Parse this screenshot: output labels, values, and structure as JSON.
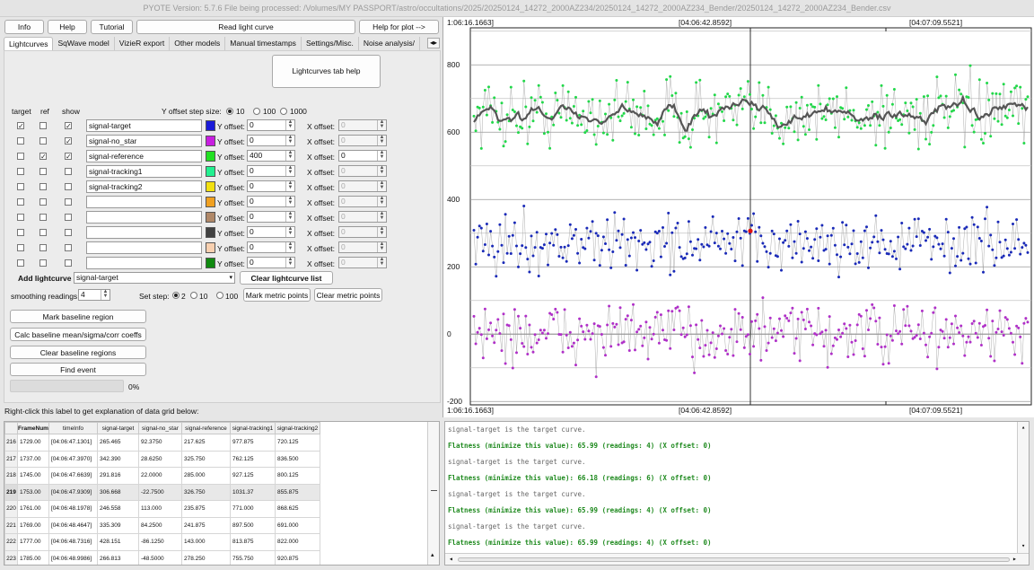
{
  "window": {
    "title": "PYOTE Version: 5.7.6  File being processed: /Volumes/MY PASSPORT/astro/occultations/2025/20250124_14272_2000AZ234/20250124_14272_2000AZ234_Bender/20250124_14272_2000AZ234_Bender.csv"
  },
  "toolbar": {
    "info": "Info",
    "help": "Help",
    "tutorial": "Tutorial",
    "read_light_curve": "Read light curve",
    "help_for_plot": "Help for plot -->"
  },
  "tabs": [
    "Lightcurves",
    "SqWave model",
    "VizieR export",
    "Other models",
    "Manual timestamps",
    "Settings/Misc.",
    "Noise analysis/"
  ],
  "lightcurves_tab": {
    "help_button": "Lightcurves tab help",
    "headers": {
      "target": "target",
      "ref": "ref",
      "show": "show"
    },
    "y_offset_step": {
      "label": "Y offset step size:",
      "options": [
        "10",
        "100",
        "1000"
      ],
      "selected": "10"
    },
    "y_offset_label": "Y offset:",
    "x_offset_label": "X offset:",
    "rows": [
      {
        "name": "signal-target",
        "target": true,
        "ref": false,
        "show": true,
        "color": "#1a1ad8",
        "y_offset": "0",
        "x_offset": "0",
        "x_enabled": false
      },
      {
        "name": "signal-no_star",
        "target": false,
        "ref": false,
        "show": true,
        "color": "#c81ee0",
        "y_offset": "0",
        "x_offset": "0",
        "x_enabled": false
      },
      {
        "name": "signal-reference",
        "target": false,
        "ref": true,
        "show": true,
        "color": "#22e022",
        "y_offset": "400",
        "x_offset": "0",
        "x_enabled": true
      },
      {
        "name": "signal-tracking1",
        "target": false,
        "ref": false,
        "show": false,
        "color": "#22f090",
        "y_offset": "0",
        "x_offset": "0",
        "x_enabled": false
      },
      {
        "name": "signal-tracking2",
        "target": false,
        "ref": false,
        "show": false,
        "color": "#f2e010",
        "y_offset": "0",
        "x_offset": "0",
        "x_enabled": false
      },
      {
        "name": "",
        "target": false,
        "ref": false,
        "show": false,
        "color": "#f0a020",
        "y_offset": "0",
        "x_offset": "0",
        "x_enabled": false
      },
      {
        "name": "",
        "target": false,
        "ref": false,
        "show": false,
        "color": "#b08868",
        "y_offset": "0",
        "x_offset": "0",
        "x_enabled": false
      },
      {
        "name": "",
        "target": false,
        "ref": false,
        "show": false,
        "color": "#404040",
        "y_offset": "0",
        "x_offset": "0",
        "x_enabled": false
      },
      {
        "name": "",
        "target": false,
        "ref": false,
        "show": false,
        "color": "#f8d0b0",
        "y_offset": "0",
        "x_offset": "0",
        "x_enabled": false
      },
      {
        "name": "",
        "target": false,
        "ref": false,
        "show": false,
        "color": "#108a10",
        "y_offset": "0",
        "x_offset": "0",
        "x_enabled": false
      }
    ],
    "add_lightcurve_label": "Add lightcurve",
    "add_lightcurve_value": "signal-target",
    "clear_list_button": "Clear lightcurve list",
    "smoothing_label": "smoothing readings",
    "smoothing_value": "4",
    "set_step_label": "Set step:",
    "set_step_options": [
      "2",
      "10",
      "100"
    ],
    "set_step_selected": "2",
    "mark_metric_button": "Mark metric points",
    "clear_metric_button": "Clear metric points",
    "mark_baseline_button": "Mark baseline region",
    "calc_baseline_button": "Calc baseline mean/sigma/corr coeffs",
    "clear_baseline_button": "Clear baseline regions",
    "find_event_button": "Find event",
    "progress_percent": 0,
    "progress_label": "0%"
  },
  "plot": {
    "top_time_labels": [
      "1:06:16.1663]",
      "[04:06:42.8592]",
      "[04:07:09.5521]"
    ],
    "bottom_time_labels": [
      "1:06:16.1663]",
      "[04:06:42.8592]",
      "[04:07:09.5521]"
    ],
    "y_ticks": [
      "800",
      "600",
      "400",
      "200",
      "0",
      "-200"
    ]
  },
  "chart_data": {
    "type": "scatter",
    "title": "",
    "xlabel": "",
    "ylabel": "",
    "ylim": [
      -210,
      910
    ],
    "y_ticks": [
      800,
      600,
      400,
      200,
      0,
      -200
    ],
    "grid": true,
    "cursor_frame": 1753,
    "highlight_point": {
      "series": "signal-target",
      "frame": 1753,
      "y": 306.668
    },
    "series": [
      {
        "name": "signal-reference",
        "color": "#22d84a",
        "mean": 655,
        "sigma": 85,
        "smoothed": true,
        "y_offset": 400
      },
      {
        "name": "signal-target",
        "color": "#1a2ab8",
        "mean": 270,
        "sigma": 70
      },
      {
        "name": "signal-no_star",
        "color": "#b030c8",
        "mean": 0,
        "sigma": 75
      }
    ]
  },
  "grid_help_label": "Right-click this label to get explanation of data grid below:",
  "data_grid": {
    "columns": [
      "FrameNum",
      "timeInfo",
      "signal-target",
      "signal-no_star",
      "signal-reference",
      "signal-tracking1",
      "signal-tracking2"
    ],
    "selected_row": "219",
    "rows": [
      {
        "row": "216",
        "cells": [
          "1729.00",
          "[04:06:47.1301]",
          "265.465",
          "92.3750",
          "217.625",
          "977.875",
          "720.125"
        ]
      },
      {
        "row": "217",
        "cells": [
          "1737.00",
          "[04:06:47.3970]",
          "342.390",
          "28.6250",
          "325.750",
          "762.125",
          "836.500"
        ]
      },
      {
        "row": "218",
        "cells": [
          "1745.00",
          "[04:06:47.6639]",
          "291.816",
          "22.0000",
          "285.000",
          "927.125",
          "800.125"
        ]
      },
      {
        "row": "219",
        "cells": [
          "1753.00",
          "[04:06:47.9309]",
          "306.668",
          "-22.7500",
          "326.750",
          "1031.37",
          "855.875"
        ]
      },
      {
        "row": "220",
        "cells": [
          "1761.00",
          "[04:06:48.1978]",
          "246.558",
          "113.000",
          "235.875",
          "771.000",
          "868.625"
        ]
      },
      {
        "row": "221",
        "cells": [
          "1769.00",
          "[04:06:48.4647]",
          "335.309",
          "84.2500",
          "241.875",
          "897.500",
          "691.000"
        ]
      },
      {
        "row": "222",
        "cells": [
          "1777.00",
          "[04:06:48.7316]",
          "428.151",
          "-86.1250",
          "143.000",
          "813.875",
          "822.000"
        ]
      },
      {
        "row": "223",
        "cells": [
          "1785.00",
          "[04:06:48.9986]",
          "266.813",
          "-48.5000",
          "278.250",
          "755.750",
          "920.875"
        ]
      }
    ]
  },
  "log": [
    {
      "text": "signal-target is the target curve.",
      "style": "gray"
    },
    {
      "text": "Flatness (minimize this value): 65.99 (readings: 4) (X offset: 0)",
      "style": "green"
    },
    {
      "text": "signal-target is the target curve.",
      "style": "gray"
    },
    {
      "text": "Flatness (minimize this value): 66.18 (readings: 6) (X offset: 0)",
      "style": "green"
    },
    {
      "text": "signal-target is the target curve.",
      "style": "gray"
    },
    {
      "text": "Flatness (minimize this value): 65.99 (readings: 4) (X offset: 0)",
      "style": "green"
    },
    {
      "text": "signal-target is the target curve.",
      "style": "gray"
    },
    {
      "text": "Flatness (minimize this value): 65.99 (readings: 4) (X offset: 0)",
      "style": "green"
    }
  ]
}
